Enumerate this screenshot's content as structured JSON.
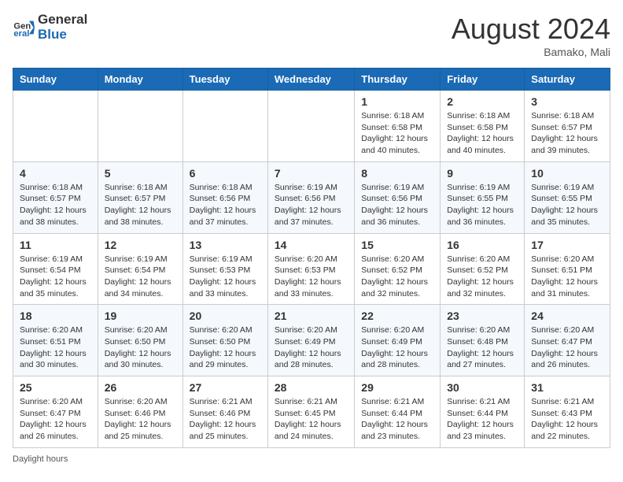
{
  "logo": {
    "line1": "General",
    "line2": "Blue"
  },
  "title": "August 2024",
  "location": "Bamako, Mali",
  "days_of_week": [
    "Sunday",
    "Monday",
    "Tuesday",
    "Wednesday",
    "Thursday",
    "Friday",
    "Saturday"
  ],
  "weeks": [
    [
      {
        "num": "",
        "info": ""
      },
      {
        "num": "",
        "info": ""
      },
      {
        "num": "",
        "info": ""
      },
      {
        "num": "",
        "info": ""
      },
      {
        "num": "1",
        "info": "Sunrise: 6:18 AM\nSunset: 6:58 PM\nDaylight: 12 hours and 40 minutes."
      },
      {
        "num": "2",
        "info": "Sunrise: 6:18 AM\nSunset: 6:58 PM\nDaylight: 12 hours and 40 minutes."
      },
      {
        "num": "3",
        "info": "Sunrise: 6:18 AM\nSunset: 6:57 PM\nDaylight: 12 hours and 39 minutes."
      }
    ],
    [
      {
        "num": "4",
        "info": "Sunrise: 6:18 AM\nSunset: 6:57 PM\nDaylight: 12 hours and 38 minutes."
      },
      {
        "num": "5",
        "info": "Sunrise: 6:18 AM\nSunset: 6:57 PM\nDaylight: 12 hours and 38 minutes."
      },
      {
        "num": "6",
        "info": "Sunrise: 6:18 AM\nSunset: 6:56 PM\nDaylight: 12 hours and 37 minutes."
      },
      {
        "num": "7",
        "info": "Sunrise: 6:19 AM\nSunset: 6:56 PM\nDaylight: 12 hours and 37 minutes."
      },
      {
        "num": "8",
        "info": "Sunrise: 6:19 AM\nSunset: 6:56 PM\nDaylight: 12 hours and 36 minutes."
      },
      {
        "num": "9",
        "info": "Sunrise: 6:19 AM\nSunset: 6:55 PM\nDaylight: 12 hours and 36 minutes."
      },
      {
        "num": "10",
        "info": "Sunrise: 6:19 AM\nSunset: 6:55 PM\nDaylight: 12 hours and 35 minutes."
      }
    ],
    [
      {
        "num": "11",
        "info": "Sunrise: 6:19 AM\nSunset: 6:54 PM\nDaylight: 12 hours and 35 minutes."
      },
      {
        "num": "12",
        "info": "Sunrise: 6:19 AM\nSunset: 6:54 PM\nDaylight: 12 hours and 34 minutes."
      },
      {
        "num": "13",
        "info": "Sunrise: 6:19 AM\nSunset: 6:53 PM\nDaylight: 12 hours and 33 minutes."
      },
      {
        "num": "14",
        "info": "Sunrise: 6:20 AM\nSunset: 6:53 PM\nDaylight: 12 hours and 33 minutes."
      },
      {
        "num": "15",
        "info": "Sunrise: 6:20 AM\nSunset: 6:52 PM\nDaylight: 12 hours and 32 minutes."
      },
      {
        "num": "16",
        "info": "Sunrise: 6:20 AM\nSunset: 6:52 PM\nDaylight: 12 hours and 32 minutes."
      },
      {
        "num": "17",
        "info": "Sunrise: 6:20 AM\nSunset: 6:51 PM\nDaylight: 12 hours and 31 minutes."
      }
    ],
    [
      {
        "num": "18",
        "info": "Sunrise: 6:20 AM\nSunset: 6:51 PM\nDaylight: 12 hours and 30 minutes."
      },
      {
        "num": "19",
        "info": "Sunrise: 6:20 AM\nSunset: 6:50 PM\nDaylight: 12 hours and 30 minutes."
      },
      {
        "num": "20",
        "info": "Sunrise: 6:20 AM\nSunset: 6:50 PM\nDaylight: 12 hours and 29 minutes."
      },
      {
        "num": "21",
        "info": "Sunrise: 6:20 AM\nSunset: 6:49 PM\nDaylight: 12 hours and 28 minutes."
      },
      {
        "num": "22",
        "info": "Sunrise: 6:20 AM\nSunset: 6:49 PM\nDaylight: 12 hours and 28 minutes."
      },
      {
        "num": "23",
        "info": "Sunrise: 6:20 AM\nSunset: 6:48 PM\nDaylight: 12 hours and 27 minutes."
      },
      {
        "num": "24",
        "info": "Sunrise: 6:20 AM\nSunset: 6:47 PM\nDaylight: 12 hours and 26 minutes."
      }
    ],
    [
      {
        "num": "25",
        "info": "Sunrise: 6:20 AM\nSunset: 6:47 PM\nDaylight: 12 hours and 26 minutes."
      },
      {
        "num": "26",
        "info": "Sunrise: 6:20 AM\nSunset: 6:46 PM\nDaylight: 12 hours and 25 minutes."
      },
      {
        "num": "27",
        "info": "Sunrise: 6:21 AM\nSunset: 6:46 PM\nDaylight: 12 hours and 25 minutes."
      },
      {
        "num": "28",
        "info": "Sunrise: 6:21 AM\nSunset: 6:45 PM\nDaylight: 12 hours and 24 minutes."
      },
      {
        "num": "29",
        "info": "Sunrise: 6:21 AM\nSunset: 6:44 PM\nDaylight: 12 hours and 23 minutes."
      },
      {
        "num": "30",
        "info": "Sunrise: 6:21 AM\nSunset: 6:44 PM\nDaylight: 12 hours and 23 minutes."
      },
      {
        "num": "31",
        "info": "Sunrise: 6:21 AM\nSunset: 6:43 PM\nDaylight: 12 hours and 22 minutes."
      }
    ]
  ],
  "footer": "Daylight hours"
}
